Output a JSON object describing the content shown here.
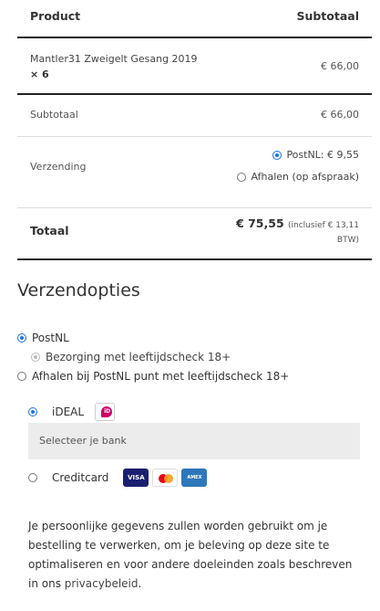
{
  "order_table": {
    "header": {
      "product": "Product",
      "subtotal": "Subtotaal"
    },
    "item": {
      "name": "Mantler31 Zweigelt Gesang 2019",
      "qty": "× 6",
      "price": "€ 66,00"
    },
    "subtotal": {
      "label": "Subtotaal",
      "value": "€ 66,00"
    },
    "shipping": {
      "label": "Verzending",
      "options": [
        {
          "label": "PostNL: € 9,55",
          "selected": true
        },
        {
          "label": "Afhalen (op afspraak)",
          "selected": false
        }
      ]
    },
    "total": {
      "label": "Totaal",
      "amount": "€ 75,55",
      "tax_note": "(inclusief € 13,11",
      "tax_note2": "BTW)"
    }
  },
  "shipping_options": {
    "title": "Verzendopties",
    "postnl": "PostNL",
    "bezorging": "Bezorging met leeftijdscheck 18+",
    "afhalen": "Afhalen bij PostNL punt met leeftijdscheck 18+"
  },
  "payment": {
    "ideal_label": "iDEAL",
    "bank_placeholder": "Selecteer je bank",
    "creditcard_label": "Creditcard",
    "cards": [
      "VISA",
      "Mastercard",
      "AMERICAN EXPRESS"
    ]
  },
  "privacy": {
    "text": "Je persoonlijke gegevens zullen worden gebruikt om je bestelling te verwerken, om je beleving op deze site te optimaliseren en voor andere doeleinden zoals beschreven in ons ",
    "link": "privacybeleid",
    "end": "."
  },
  "colors": {
    "accent": "#1a73e8",
    "ideal": "#cc0066"
  }
}
